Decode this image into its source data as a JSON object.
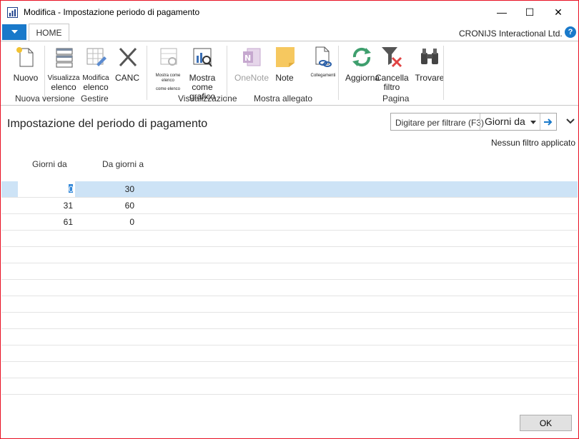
{
  "window": {
    "title": "Modifica - Impostazione periodo di pagamento",
    "minimize_glyph": "—",
    "maximize_glyph": "☐",
    "close_glyph": "✕"
  },
  "ribbon": {
    "tab_home": "HOME",
    "company": "CRONIJS Interactional Ltd.",
    "help_glyph": "?",
    "buttons": {
      "nuovo": "Nuovo",
      "visualizza_l1": "Visualizza",
      "visualizza_l2": "elenco",
      "modifica_l1": "Modifica",
      "modifica_l2": "elenco",
      "canc": "CANC",
      "mostra_elenco_l1": "Mostra come elenco",
      "mostra_elenco_l2": "come elenco",
      "mostra_grafico_l1": "Mostra come",
      "mostra_grafico_l2": "grafico",
      "onenote": "OneNote",
      "note": "Note",
      "collegamenti": "Collegamenti",
      "aggiorna": "Aggiorna",
      "cancella_l1": "Cancella",
      "cancella_l2": "filtro",
      "trovare": "Trovare"
    },
    "groups": {
      "nuova_versione": "Nuova versione",
      "gestire": "Gestire",
      "visualizzazione": "Visualizzazione",
      "mostra_allegato": "Mostra allegato",
      "pagina": "Pagina"
    }
  },
  "page": {
    "title": "Impostazione del periodo di pagamento",
    "filter_placeholder": "Digitare per filtrare (F3)",
    "filter_field": "Giorni da",
    "no_filter": "Nessun filtro applicato"
  },
  "table": {
    "columns": [
      "Giorni da",
      "Da giorni a"
    ],
    "rows": [
      {
        "giorni_da": "0",
        "da_giorni_a": "30"
      },
      {
        "giorni_da": "31",
        "da_giorni_a": "60"
      },
      {
        "giorni_da": "61",
        "da_giorni_a": "0"
      }
    ]
  },
  "footer": {
    "ok_label": "OK"
  },
  "colors": {
    "accent": "#1979ca",
    "selected_row": "#cde3f6",
    "window_border": "#e81123"
  }
}
